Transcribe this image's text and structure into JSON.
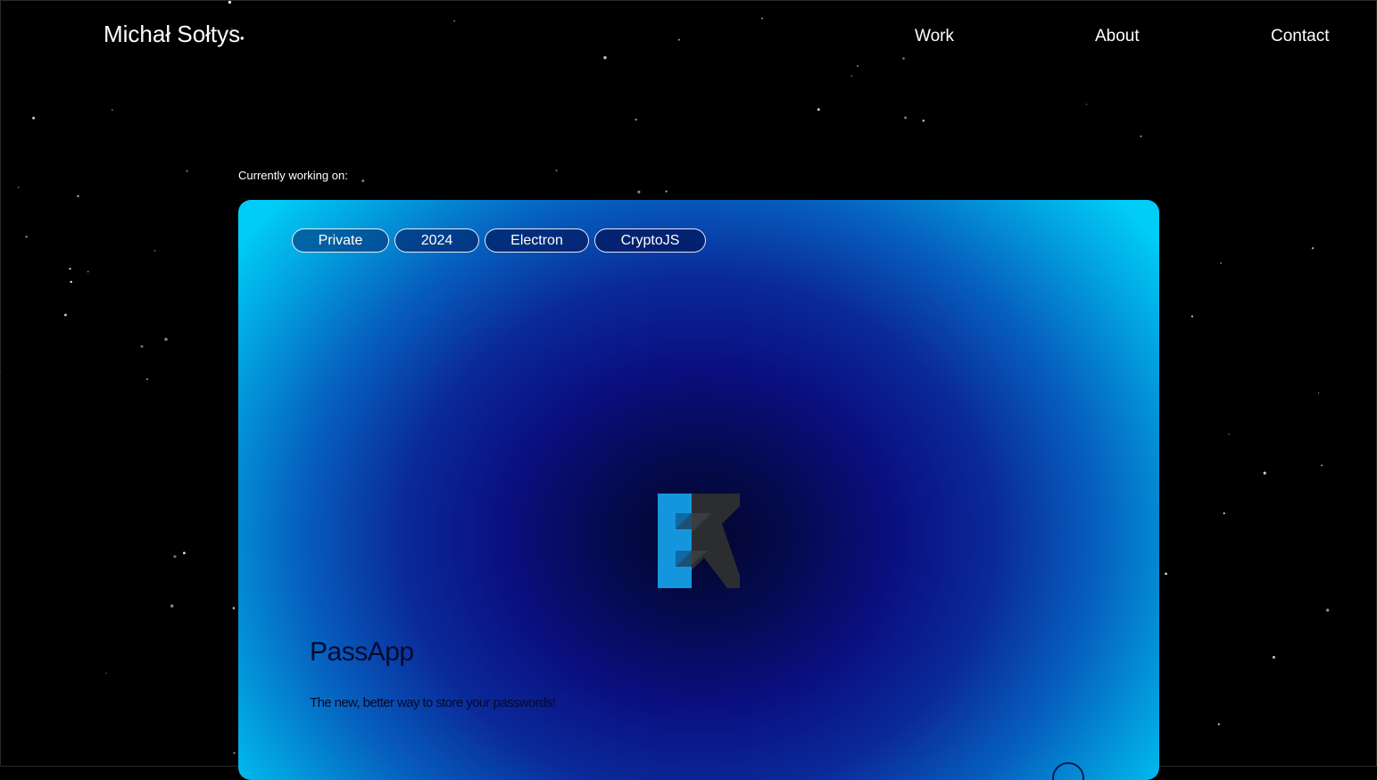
{
  "header": {
    "brand": "Michał Sołtys",
    "nav": {
      "work": "Work",
      "about": "About",
      "contact": "Contact"
    }
  },
  "featured": {
    "label": "Currently working on:",
    "project": {
      "tags": [
        "Private",
        "2024",
        "Electron",
        "CryptoJS"
      ],
      "logo_icon": "passapp-logo-icon",
      "title": "PassApp",
      "description": "The new, better way to store your passwords!",
      "arrow_icon": "circle-arrow-icon"
    }
  },
  "colors": {
    "background": "#000000",
    "text": "#ffffff",
    "card_edge": "#00cdf7",
    "card_center": "#03062a",
    "logo_blue": "#1496dc",
    "logo_dark": "#2b2d30"
  }
}
